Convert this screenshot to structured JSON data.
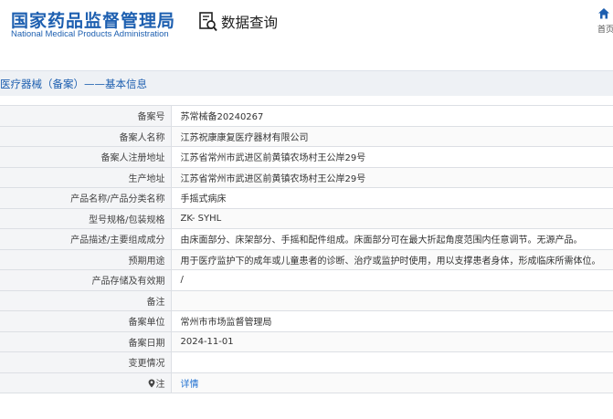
{
  "header": {
    "logo_cn": "国家药品监督管理局",
    "logo_en": "National Medical Products Administration",
    "query_title": "数据查询",
    "home_label": "首页"
  },
  "section": {
    "title": "医疗器械（备案）——基本信息"
  },
  "rows": [
    {
      "label": "备案号",
      "value": "苏常械备20240267"
    },
    {
      "label": "备案人名称",
      "value": "江苏祝康康复医疗器材有限公司"
    },
    {
      "label": "备案人注册地址",
      "value": "江苏省常州市武进区前黄镇农场村王公岸29号"
    },
    {
      "label": "生产地址",
      "value": "江苏省常州市武进区前黄镇农场村王公岸29号"
    },
    {
      "label": "产品名称/产品分类名称",
      "value": "手摇式病床"
    },
    {
      "label": "型号规格/包装规格",
      "value": "ZK- SYHL"
    },
    {
      "label": "产品描述/主要组成成分",
      "value": "由床面部分、床架部分、手摇和配件组成。床面部分可在最大折起角度范围内任意调节。无源产品。"
    },
    {
      "label": "预期用途",
      "value": "用于医疗监护下的成年或儿童患者的诊断、治疗或监护时使用，用以支撑患者身体，形成临床所需体位。"
    },
    {
      "label": "产品存储及有效期",
      "value": "/"
    },
    {
      "label": "备注",
      "value": ""
    },
    {
      "label": "备案单位",
      "value": "常州市市场监督管理局"
    },
    {
      "label": "备案日期",
      "value": "2024-11-01"
    },
    {
      "label": "变更情况",
      "value": ""
    }
  ],
  "note_row": {
    "label": "注",
    "link": "详情"
  },
  "colors": {
    "brand_blue": "#1d5fb0",
    "link_blue": "#1d6fd0",
    "label_bg": "#f4f5f7",
    "section_bg": "#eef1f5"
  }
}
